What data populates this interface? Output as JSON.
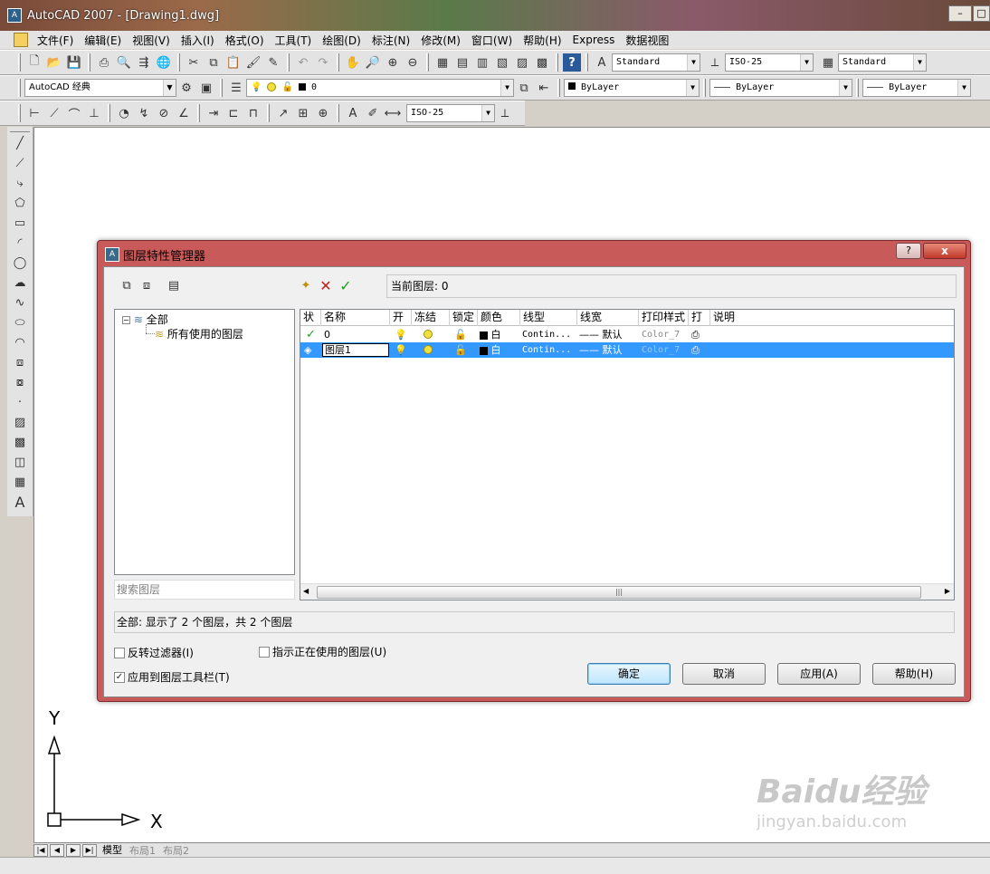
{
  "window": {
    "title": "AutoCAD 2007 - [Drawing1.dwg]"
  },
  "menu": [
    "文件(F)",
    "编辑(E)",
    "视图(V)",
    "插入(I)",
    "格式(O)",
    "工具(T)",
    "绘图(D)",
    "标注(N)",
    "修改(M)",
    "窗口(W)",
    "帮助(H)",
    "Express",
    "数据视图"
  ],
  "toolbar": {
    "text_style": "Standard",
    "dim_style": "ISO-25",
    "table_style": "Standard",
    "workspace": "AutoCAD 经典",
    "layer_current": "0",
    "color": "ByLayer",
    "linetype": "ByLayer",
    "lineweight": "ByLayer",
    "dim_style2": "ISO-25"
  },
  "dialog": {
    "title": "图层特性管理器",
    "current_layer_label": "当前图层: 0",
    "tree": {
      "root": "全部",
      "child": "所有使用的图层"
    },
    "search_placeholder": "搜索图层",
    "columns": [
      "状",
      "名称",
      "开",
      "冻结",
      "锁定",
      "颜色",
      "线型",
      "线宽",
      "打印样式",
      "打",
      "说明"
    ],
    "layers": [
      {
        "name": "0",
        "color": "白",
        "linetype": "Contin...",
        "lineweight": "默认",
        "plotstyle": "Color_7",
        "current": true,
        "selected": false
      },
      {
        "name": "图层1",
        "color": "白",
        "linetype": "Contin...",
        "lineweight": "默认",
        "plotstyle": "Color_7",
        "current": false,
        "selected": true
      }
    ],
    "summary": "全部: 显示了 2 个图层，共 2 个图层",
    "invert_filter": "反转过滤器(I)",
    "indicate_in_use": "指示正在使用的图层(U)",
    "apply_to_toolbar": "应用到图层工具栏(T)",
    "ok": "确定",
    "cancel": "取消",
    "apply": "应用(A)",
    "help": "帮助(H)",
    "help_button": "?",
    "close_button": "x"
  },
  "tabs": [
    "模型",
    "布局1",
    "布局2"
  ],
  "ucs": {
    "x": "X",
    "y": "Y"
  },
  "watermark": {
    "brand": "Baidu经验",
    "url": "jingyan.baidu.com"
  }
}
